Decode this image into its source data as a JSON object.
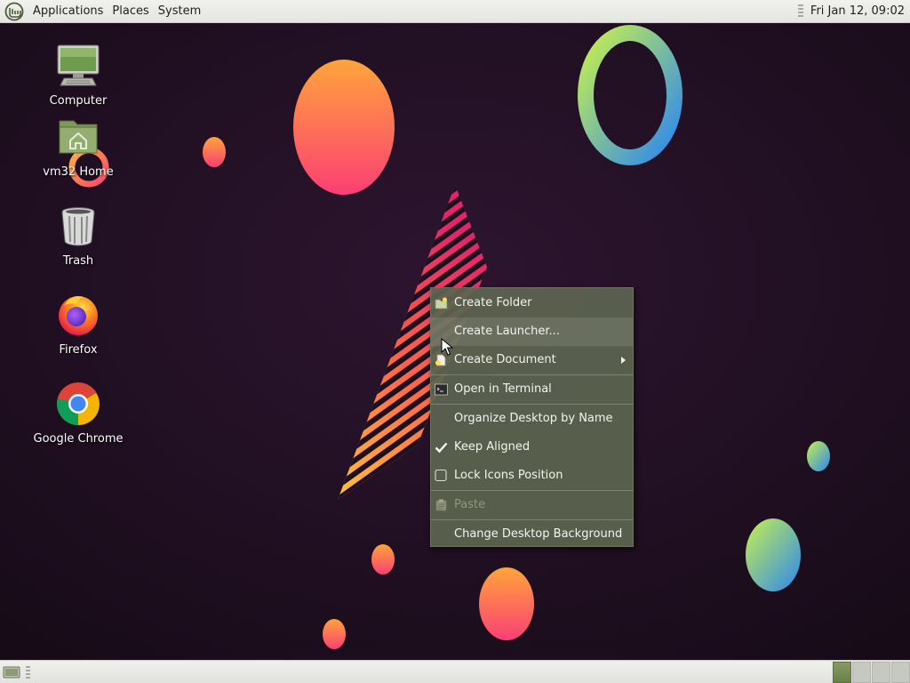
{
  "top_panel": {
    "menus": [
      "Applications",
      "Places",
      "System"
    ],
    "clock": "Fri Jan 12, 09:02"
  },
  "desktop_icons": [
    {
      "label": "Computer",
      "icon": "computer-icon"
    },
    {
      "label": "vm32 Home",
      "icon": "home-folder-icon"
    },
    {
      "label": "Trash",
      "icon": "trash-icon"
    },
    {
      "label": "Firefox",
      "icon": "firefox-icon"
    },
    {
      "label": "Google Chrome",
      "icon": "chrome-icon"
    }
  ],
  "context_menu": {
    "items": [
      {
        "label": "Create Folder",
        "icon": "new-folder-icon",
        "enabled": true
      },
      {
        "label": "Create Launcher...",
        "icon": "",
        "enabled": true
      },
      {
        "label": "Create Document",
        "icon": "new-document-icon",
        "enabled": true,
        "submenu": true
      },
      {
        "label": "Open in Terminal",
        "icon": "terminal-icon",
        "enabled": true
      },
      {
        "label": "Organize Desktop by Name",
        "icon": "",
        "enabled": true
      },
      {
        "label": "Keep Aligned",
        "icon": "checkmark-icon",
        "checked": true,
        "enabled": true
      },
      {
        "label": "Lock Icons Position",
        "icon": "checkbox-icon",
        "checked": false,
        "enabled": true
      },
      {
        "label": "Paste",
        "icon": "paste-icon",
        "enabled": false
      },
      {
        "label": "Change Desktop Background",
        "icon": "",
        "enabled": true
      }
    ]
  },
  "bottom_panel": {
    "workspaces": 4,
    "active_workspace": 1
  },
  "colors": {
    "panel_bg": "#e8e8e4",
    "menu_bg": "#5c6450",
    "wallpaper_bg": "#1d0f1f",
    "active_workspace": "#7a8d57"
  }
}
